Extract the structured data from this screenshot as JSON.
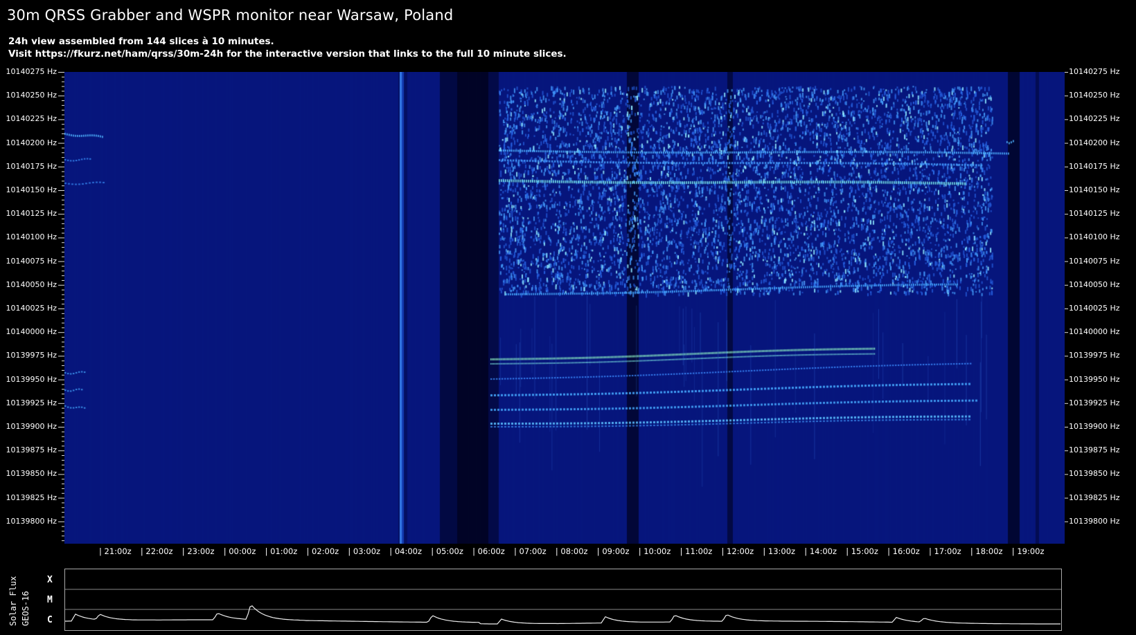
{
  "header": {
    "title": "30m QRSS Grabber and WSPR monitor near Warsaw, Poland",
    "subtitle_line1": "24h view assembled from 144 slices à 10 minutes.",
    "subtitle_line2": "Visit https://fkurz.net/ham/qrss/30m-24h for the interactive version that links to the full 10 minute slices."
  },
  "frequency_axis": {
    "labels": [
      "10140275 Hz",
      "10140250 Hz",
      "10140225 Hz",
      "10140200 Hz",
      "10140175 Hz",
      "10140150 Hz",
      "10140125 Hz",
      "10140100 Hz",
      "10140075 Hz",
      "10140050 Hz",
      "10140025 Hz",
      "10140000 Hz",
      "10139975 Hz",
      "10139950 Hz",
      "10139925 Hz",
      "10139900 Hz",
      "10139875 Hz",
      "10139850 Hz",
      "10139825 Hz",
      "10139800 Hz"
    ]
  },
  "time_axis": {
    "labels": [
      "| 21:00z",
      "| 22:00z",
      "| 23:00z",
      "| 00:00z",
      "| 01:00z",
      "| 02:00z",
      "| 03:00z",
      "| 04:00z",
      "| 05:00z",
      "| 06:00z",
      "| 07:00z",
      "| 08:00z",
      "| 09:00z",
      "| 10:00z",
      "| 11:00z",
      "| 12:00z",
      "| 13:00z",
      "| 14:00z",
      "| 15:00z",
      "| 16:00z",
      "| 17:00z",
      "| 18:00z",
      "| 19:00z"
    ]
  },
  "solar_flux": {
    "axis_title_1": "Solar Flux",
    "axis_title_2": "GEOS-16",
    "classes": [
      "X",
      "M",
      "C"
    ]
  },
  "colors": {
    "background": "#000000",
    "waterfall_base": "#06157a",
    "signal_bright": "#4fd0ff",
    "signal_peak": "#b8ff9a"
  }
}
